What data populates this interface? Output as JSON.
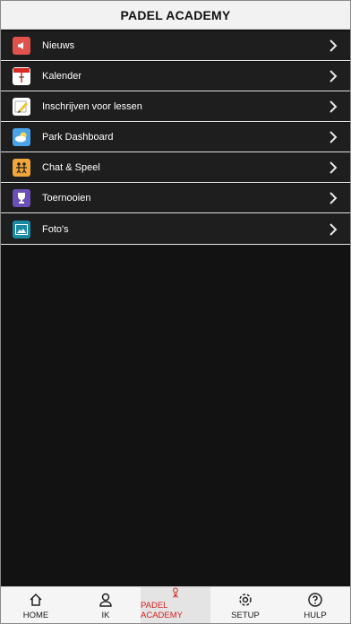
{
  "header": {
    "title": "PADEL ACADEMY"
  },
  "menu": {
    "items": [
      {
        "label": "Nieuws",
        "icon": "megaphone-icon"
      },
      {
        "label": "Kalender",
        "icon": "calendar-icon"
      },
      {
        "label": "Inschrijven voor lessen",
        "icon": "pencil-form-icon"
      },
      {
        "label": "Park Dashboard",
        "icon": "weather-cloud-icon"
      },
      {
        "label": "Chat & Speel",
        "icon": "players-icon"
      },
      {
        "label": "Toernooien",
        "icon": "trophy-icon"
      },
      {
        "label": "Foto's",
        "icon": "photo-icon"
      }
    ]
  },
  "tabbar": {
    "active": "padel-academy",
    "tabs": [
      {
        "label": "HOME",
        "icon": "home-icon"
      },
      {
        "label": "IK",
        "icon": "user-icon"
      },
      {
        "label": "PADEL ACADEMY",
        "icon": "padel-player-icon"
      },
      {
        "label": "SETUP",
        "icon": "gear-icon"
      },
      {
        "label": "HULP",
        "icon": "help-icon"
      }
    ]
  },
  "colors": {
    "accent": "#d0211c",
    "menu_bg": "#1e1e1e",
    "page_bg": "#121212"
  }
}
